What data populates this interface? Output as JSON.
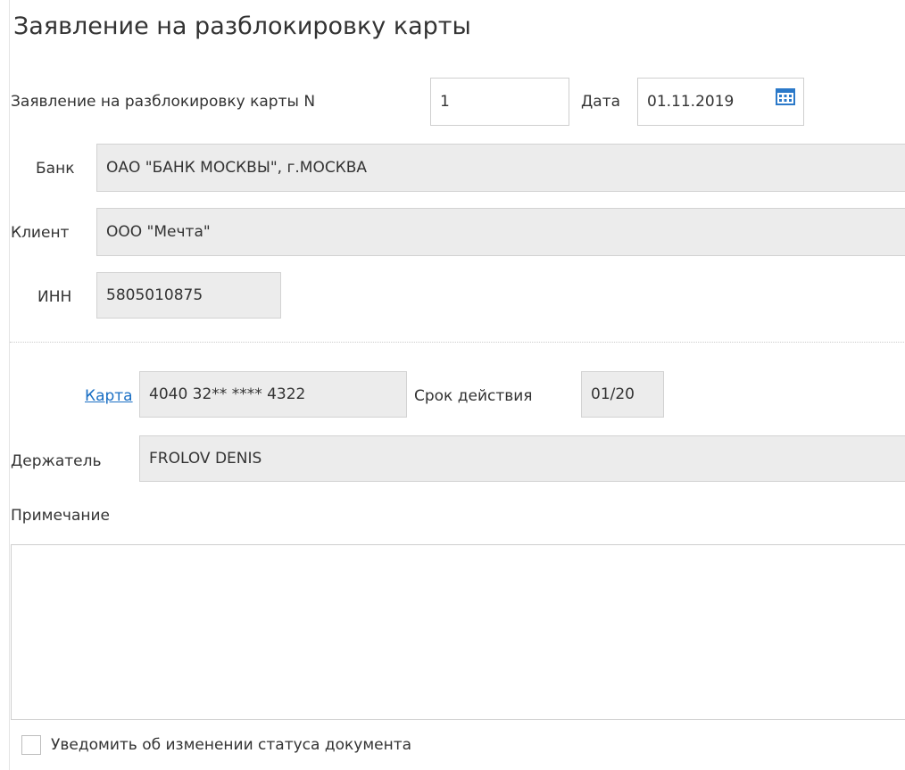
{
  "form": {
    "title": "Заявление на разблокировку карты",
    "number_label": "Заявление на разблокировку карты N",
    "number_value": "1",
    "date_label": "Дата",
    "date_value": "01.11.2019",
    "bank_label": "Банк",
    "bank_value": "ОАО \"БАНК МОСКВЫ\", г.МОСКВА",
    "client_label": "Клиент",
    "client_value": "ООО \"Мечта\"",
    "inn_label": "ИНН",
    "inn_value": "5805010875",
    "card_label": "Карта",
    "card_value": "4040 32** **** 4322",
    "expiry_label": "Срок действия",
    "expiry_value": "01/20",
    "holder_label": "Держатель",
    "holder_value": "FROLOV DENIS",
    "note_label": "Примечание",
    "note_value": "",
    "notify_label": "Уведомить об изменении статуса документа",
    "notify_checked": false
  },
  "icons": {
    "date_picker": "calendar-icon"
  },
  "colors": {
    "link": "#1a6fc4",
    "readonly_bg": "#ececec",
    "calendar_icon": "#2b79c9"
  }
}
